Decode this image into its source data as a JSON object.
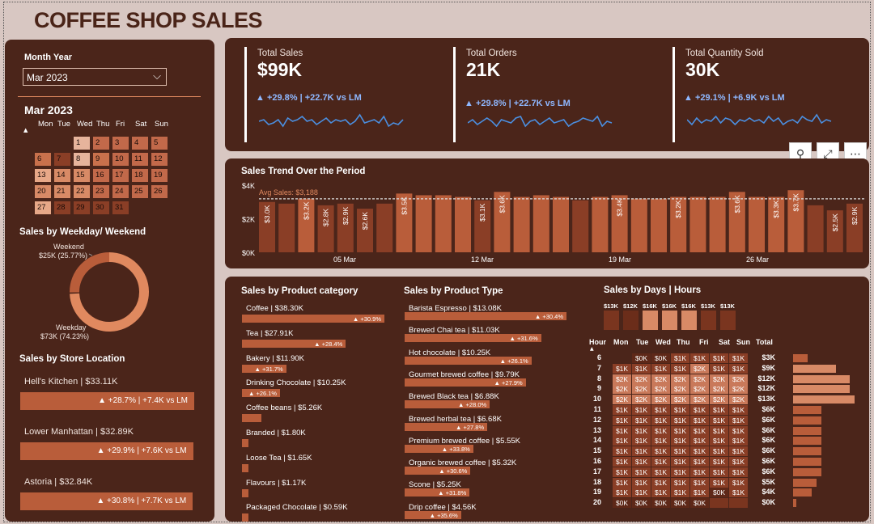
{
  "title": "COFFEE SHOP SALES",
  "filter": {
    "label": "Month Year",
    "value": "Mar 2023"
  },
  "calendar": {
    "title": "Mar 2023",
    "days": [
      "Mon",
      "Tue",
      "Wed",
      "Thu",
      "Fri",
      "Sat",
      "Sun"
    ],
    "dates": [
      "1",
      "2",
      "3",
      "4",
      "5",
      "6",
      "7",
      "8",
      "9",
      "10",
      "11",
      "12",
      "13",
      "14",
      "15",
      "16",
      "17",
      "18",
      "19",
      "20",
      "21",
      "22",
      "23",
      "24",
      "25",
      "26",
      "27",
      "28",
      "29",
      "30",
      "31"
    ]
  },
  "kpis": [
    {
      "label": "Total Sales",
      "value": "$99K",
      "change": "▲ +29.8% | +22.7K vs LM"
    },
    {
      "label": "Total Orders",
      "value": "21K",
      "change": "▲ +29.8% | +22.7K vs LM"
    },
    {
      "label": "Total Quantity Sold",
      "value": "30K",
      "change": "▲ +29.1% | +6.9K vs LM"
    }
  ],
  "weekday": {
    "title": "Sales by Weekday/ Weekend",
    "weekend_label": "Weekend",
    "weekend_value": "$25K (25.77%)",
    "weekday_label": "Weekday",
    "weekday_value": "$73K (74.23%)"
  },
  "stores": {
    "title": "Sales by Store Location",
    "items": [
      {
        "name": "Hell's Kitchen | $33.11K",
        "change": "▲ +28.7% | +7.4K vs LM"
      },
      {
        "name": "Lower Manhattan | $32.89K",
        "change": "▲ +29.9% | +7.6K vs LM"
      },
      {
        "name": "Astoria | $32.84K",
        "change": "▲ +30.8% | +7.7K vs LM"
      }
    ]
  },
  "trend": {
    "title": "Sales Trend Over the Period",
    "avg_label": "Avg Sales: $3,188",
    "yticks": [
      "$4K",
      "$2K",
      "$0K"
    ],
    "xticks": [
      "05 Mar",
      "12 Mar",
      "19 Mar",
      "26 Mar"
    ]
  },
  "categories": {
    "title": "Sales by Product category",
    "items": [
      {
        "name": "Coffee | $38.30K",
        "change": "▲ +30.9%"
      },
      {
        "name": "Tea | $27.91K",
        "change": "▲ +28.4%"
      },
      {
        "name": "Bakery | $11.90K",
        "change": "▲ +31.7%"
      },
      {
        "name": "Drinking Chocolate | $10.25K",
        "change": "▲ +26.1%"
      },
      {
        "name": "Coffee beans | $5.26K",
        "change": ""
      },
      {
        "name": "Branded | $1.80K",
        "change": ""
      },
      {
        "name": "Loose Tea | $1.65K",
        "change": ""
      },
      {
        "name": "Flavours | $1.17K",
        "change": ""
      },
      {
        "name": "Packaged Chocolate | $0.59K",
        "change": ""
      }
    ]
  },
  "types": {
    "title": "Sales by Product Type",
    "items": [
      {
        "name": "Barista Espresso | $13.08K",
        "change": "▲ +30.4%"
      },
      {
        "name": "Brewed Chai tea | $11.03K",
        "change": "▲ +31.6%"
      },
      {
        "name": "Hot chocolate | $10.25K",
        "change": "▲ +26.1%"
      },
      {
        "name": "Gourmet brewed coffee | $9.79K",
        "change": "▲ +27.9%"
      },
      {
        "name": "Brewed Black tea | $6.88K",
        "change": "▲ +28.0%"
      },
      {
        "name": "Brewed herbal tea | $6.68K",
        "change": "▲ +27.8%"
      },
      {
        "name": "Premium brewed coffee | $5.55K",
        "change": "▲ +33.8%"
      },
      {
        "name": "Organic brewed coffee | $5.32K",
        "change": "▲ +30.6%"
      },
      {
        "name": "Scone | $5.25K",
        "change": "▲ +31.8%"
      },
      {
        "name": "Drip coffee | $4.56K",
        "change": "▲ +35.6%"
      }
    ]
  },
  "heatmap": {
    "title": "Sales by Days | Hours",
    "day_totals": [
      "$13K",
      "$12K",
      "$16K",
      "$16K",
      "$16K",
      "$13K",
      "$13K"
    ],
    "headers": [
      "Hour",
      "Mon",
      "Tue",
      "Wed",
      "Thu",
      "Fri",
      "Sat",
      "Sun",
      "Total"
    ],
    "hours": [
      "6",
      "7",
      "8",
      "9",
      "10",
      "11",
      "12",
      "13",
      "14",
      "15",
      "16",
      "17",
      "18",
      "19",
      "20"
    ],
    "cells": [
      [
        "",
        "$0K",
        "$0K",
        "$1K",
        "$1K",
        "$1K",
        "$1K"
      ],
      [
        "$1K",
        "$1K",
        "$1K",
        "$1K",
        "$2K",
        "$1K",
        "$1K"
      ],
      [
        "$2K",
        "$2K",
        "$2K",
        "$2K",
        "$2K",
        "$2K",
        "$2K"
      ],
      [
        "$2K",
        "$2K",
        "$2K",
        "$2K",
        "$2K",
        "$2K",
        "$2K"
      ],
      [
        "$2K",
        "$2K",
        "$2K",
        "$2K",
        "$2K",
        "$2K",
        "$2K"
      ],
      [
        "$1K",
        "$1K",
        "$1K",
        "$1K",
        "$1K",
        "$1K",
        "$1K"
      ],
      [
        "$1K",
        "$1K",
        "$1K",
        "$1K",
        "$1K",
        "$1K",
        "$1K"
      ],
      [
        "$1K",
        "$1K",
        "$1K",
        "$1K",
        "$1K",
        "$1K",
        "$1K"
      ],
      [
        "$1K",
        "$1K",
        "$1K",
        "$1K",
        "$1K",
        "$1K",
        "$1K"
      ],
      [
        "$1K",
        "$1K",
        "$1K",
        "$1K",
        "$1K",
        "$1K",
        "$1K"
      ],
      [
        "$1K",
        "$1K",
        "$1K",
        "$1K",
        "$1K",
        "$1K",
        "$1K"
      ],
      [
        "$1K",
        "$1K",
        "$1K",
        "$1K",
        "$1K",
        "$1K",
        "$1K"
      ],
      [
        "$1K",
        "$1K",
        "$1K",
        "$1K",
        "$1K",
        "$1K",
        "$1K"
      ],
      [
        "$1K",
        "$1K",
        "$1K",
        "$1K",
        "$1K",
        "$0K",
        "$1K"
      ],
      [
        "$0K",
        "$0K",
        "$0K",
        "$0K",
        "$0K",
        "",
        ""
      ]
    ],
    "totals": [
      "$3K",
      "$9K",
      "$12K",
      "$12K",
      "$13K",
      "$6K",
      "$6K",
      "$6K",
      "$6K",
      "$6K",
      "$6K",
      "$6K",
      "$5K",
      "$4K",
      "$0K"
    ]
  },
  "chart_data": [
    {
      "type": "bar",
      "title": "Sales Trend Over the Period",
      "categories": [
        "1",
        "2",
        "3",
        "4",
        "5",
        "6",
        "7",
        "8",
        "9",
        "10",
        "11",
        "12",
        "13",
        "14",
        "15",
        "16",
        "17",
        "18",
        "19",
        "20",
        "21",
        "22",
        "23",
        "24",
        "25",
        "26",
        "27",
        "28",
        "29",
        "30",
        "31"
      ],
      "values": [
        3.0,
        2.9,
        3.2,
        2.8,
        2.9,
        2.6,
        2.9,
        3.5,
        3.4,
        3.4,
        3.3,
        3.1,
        3.6,
        3.3,
        3.4,
        3.3,
        3.1,
        3.3,
        3.4,
        3.2,
        3.2,
        3.3,
        3.3,
        3.3,
        3.6,
        3.3,
        3.3,
        3.7,
        2.8,
        2.5,
        2.9
      ],
      "labels": {
        "1": "$3.0K",
        "3": "$3.2K",
        "4": "$2.8K",
        "5": "$2.9K",
        "6": "$2.6K",
        "8": "$3.5K",
        "12": "$3.1K",
        "13": "$3.6K",
        "19": "$3.4K",
        "22": "$3.2K",
        "25": "$3.6K",
        "27": "$3.3K",
        "28": "$3.7K",
        "30": "$2.5K",
        "31": "$2.9K"
      },
      "avg": 3.188,
      "ylim": [
        0,
        4
      ],
      "ylabel_unit": "$K"
    },
    {
      "type": "pie",
      "title": "Sales by Weekday/ Weekend",
      "categories": [
        "Weekday",
        "Weekend"
      ],
      "values": [
        74.23,
        25.77
      ]
    },
    {
      "type": "bar",
      "title": "Sales by Product category",
      "categories": [
        "Coffee",
        "Tea",
        "Bakery",
        "Drinking Chocolate",
        "Coffee beans",
        "Branded",
        "Loose Tea",
        "Flavours",
        "Packaged Chocolate"
      ],
      "values": [
        38.3,
        27.91,
        11.9,
        10.25,
        5.26,
        1.8,
        1.65,
        1.17,
        0.59
      ]
    },
    {
      "type": "bar",
      "title": "Sales by Product Type",
      "categories": [
        "Barista Espresso",
        "Brewed Chai tea",
        "Hot chocolate",
        "Gourmet brewed coffee",
        "Brewed Black tea",
        "Brewed herbal tea",
        "Premium brewed coffee",
        "Organic brewed coffee",
        "Scone",
        "Drip coffee"
      ],
      "values": [
        13.08,
        11.03,
        10.25,
        9.79,
        6.88,
        6.68,
        5.55,
        5.32,
        5.25,
        4.56
      ]
    },
    {
      "type": "bar",
      "title": "Sales by Store Location",
      "categories": [
        "Hell's Kitchen",
        "Lower Manhattan",
        "Astoria"
      ],
      "values": [
        33.11,
        32.89,
        32.84
      ]
    },
    {
      "type": "bar",
      "title": "Sales by Days | Hours — hourly totals",
      "categories": [
        "6",
        "7",
        "8",
        "9",
        "10",
        "11",
        "12",
        "13",
        "14",
        "15",
        "16",
        "17",
        "18",
        "19",
        "20"
      ],
      "values": [
        3,
        9,
        12,
        12,
        13,
        6,
        6,
        6,
        6,
        6,
        6,
        6,
        5,
        4,
        0.3
      ]
    }
  ],
  "colors": {
    "bg": "#d8c7c2",
    "panel": "#4b251a",
    "bar": "#b95d3a",
    "accent": "#e0895f",
    "change": "#8fb8ff"
  }
}
